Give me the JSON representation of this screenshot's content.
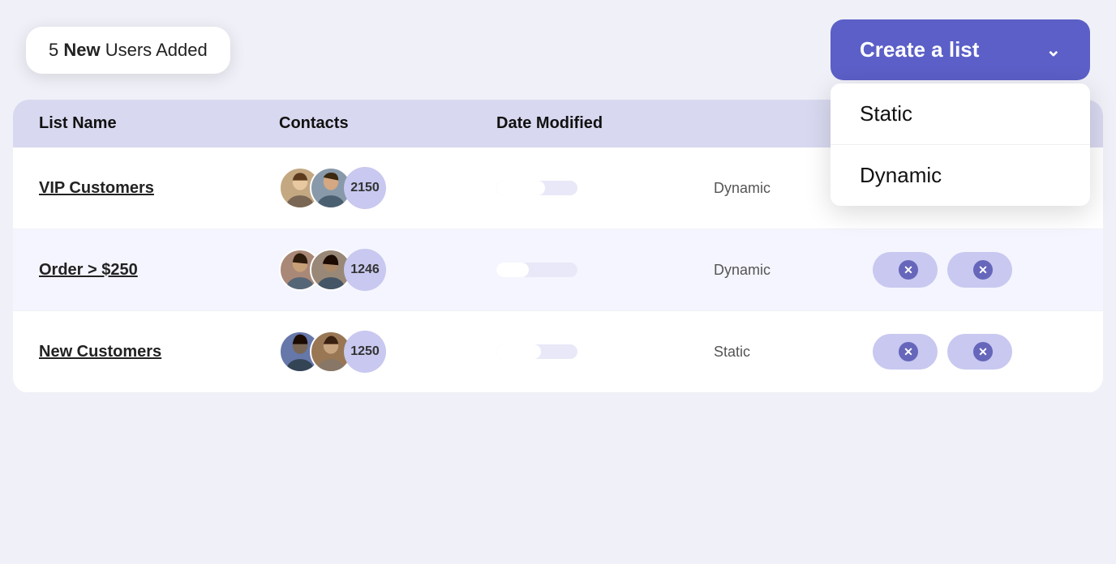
{
  "header": {
    "notification": {
      "prefix": "5 ",
      "bold": "New",
      "suffix": " Users Added"
    },
    "create_button_label": "Create a list",
    "dropdown": {
      "items": [
        {
          "label": "Static",
          "value": "static"
        },
        {
          "label": "Dynamic",
          "value": "dynamic"
        }
      ]
    }
  },
  "table": {
    "headers": [
      "List Name",
      "Contacts",
      "Date Modified",
      "",
      ""
    ],
    "rows": [
      {
        "id": "vip-customers",
        "name": "VIP Customers",
        "contacts_count": "2150",
        "type": "Dynamic",
        "avatars": [
          "p1",
          "p2"
        ]
      },
      {
        "id": "order-250",
        "name": "Order > $250",
        "contacts_count": "1246",
        "type": "Dynamic",
        "avatars": [
          "p3",
          "p4"
        ]
      },
      {
        "id": "new-customers",
        "name": "New Customers",
        "contacts_count": "1250",
        "type": "Static",
        "avatars": [
          "p5",
          "p6"
        ]
      }
    ]
  }
}
